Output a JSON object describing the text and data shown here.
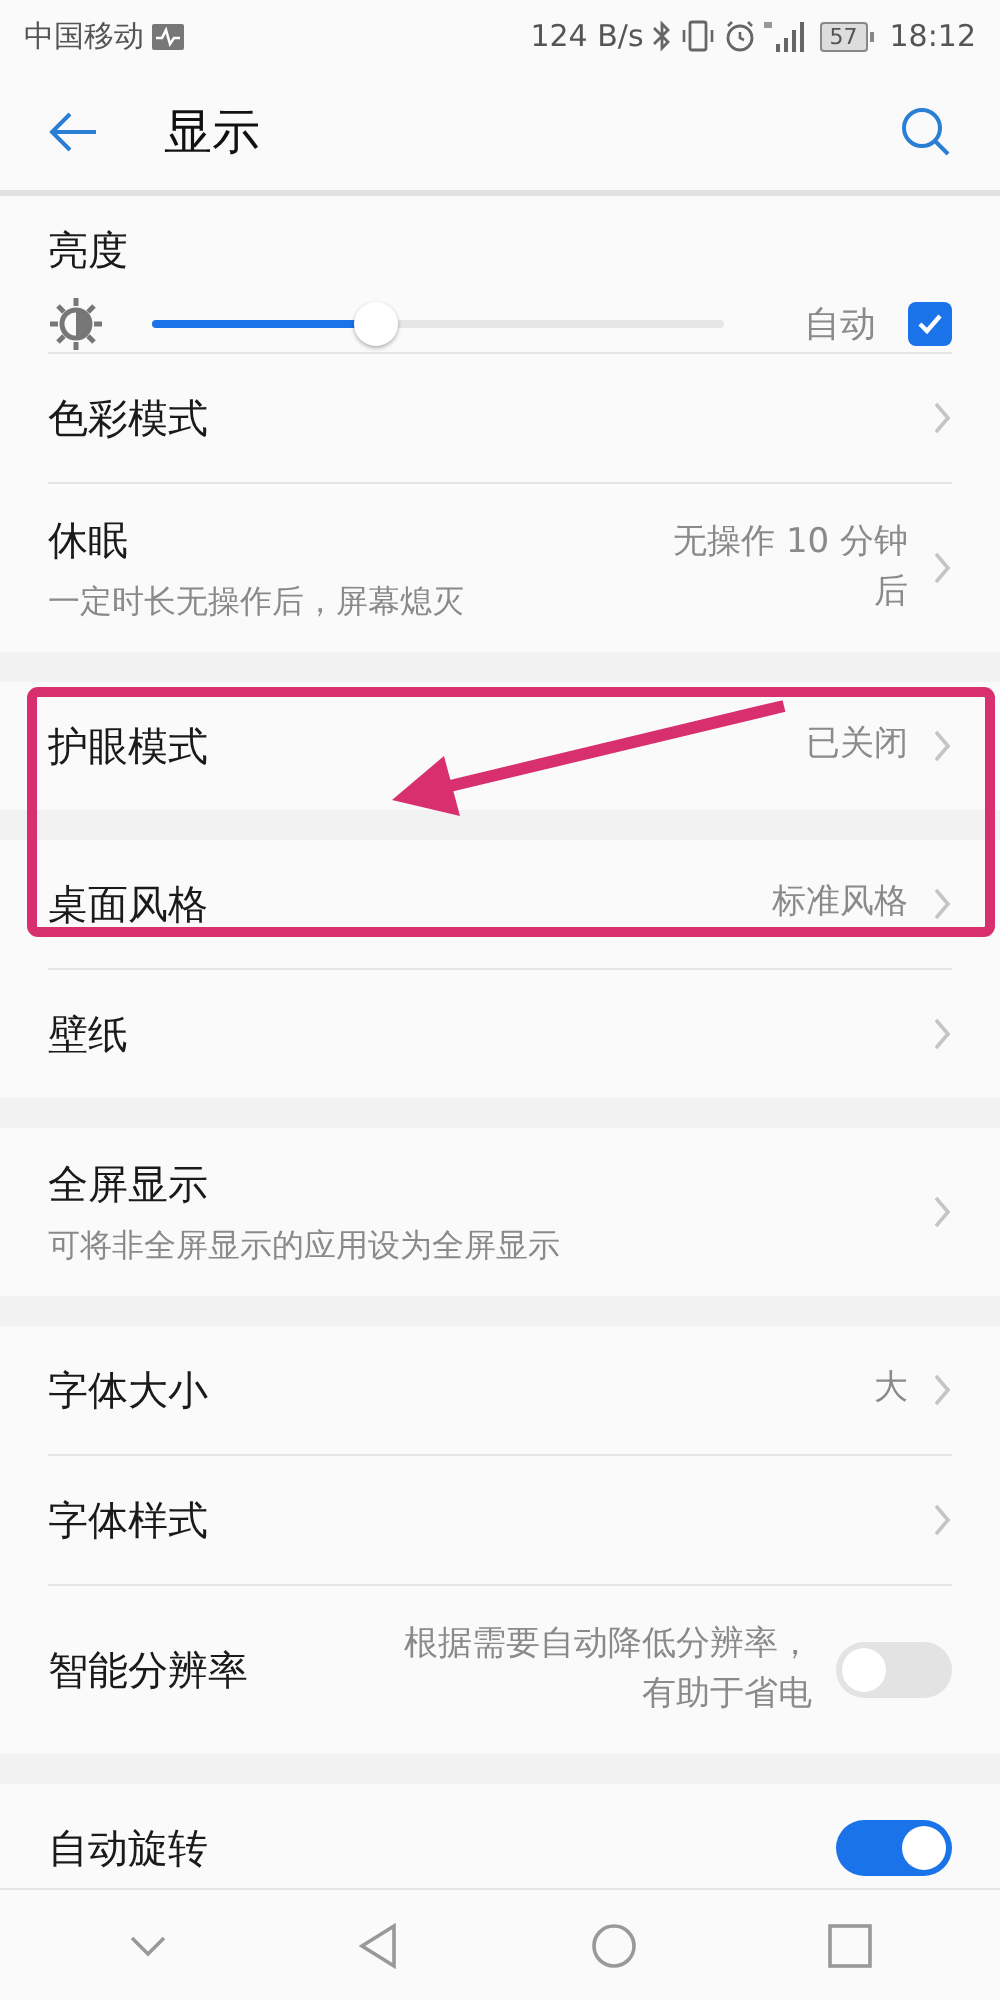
{
  "status_bar": {
    "carrier": "中国移动",
    "speed": "124 B/s",
    "battery": "57",
    "time": "18:12"
  },
  "header": {
    "title": "显示"
  },
  "brightness": {
    "label": "亮度",
    "level": 0.39,
    "auto_label": "自动",
    "auto_checked": true
  },
  "sections": [
    {
      "items": [
        {
          "kind": "nav",
          "title": "色彩模式"
        },
        {
          "kind": "nav",
          "title": "休眠",
          "subtitle": "一定时长无操作后，屏幕熄灭",
          "value": "无操作 10 分钟后"
        }
      ]
    },
    {
      "items": [
        {
          "kind": "nav",
          "title": "护眼模式",
          "value": "已关闭"
        }
      ]
    },
    {
      "items": [
        {
          "kind": "nav",
          "title": "桌面风格",
          "value": "标准风格"
        },
        {
          "kind": "nav",
          "title": "壁纸"
        }
      ]
    },
    {
      "items": [
        {
          "kind": "nav",
          "title": "全屏显示",
          "subtitle": "可将非全屏显示的应用设为全屏显示"
        }
      ]
    },
    {
      "items": [
        {
          "kind": "nav",
          "title": "字体大小",
          "value": "大"
        },
        {
          "kind": "nav",
          "title": "字体样式"
        },
        {
          "kind": "toggle",
          "title": "智能分辨率",
          "value": "根据需要自动降低分辨率，有助于省电",
          "on": false
        }
      ]
    },
    {
      "items": [
        {
          "kind": "toggle",
          "title": "自动旋转",
          "on": true
        }
      ]
    }
  ]
}
